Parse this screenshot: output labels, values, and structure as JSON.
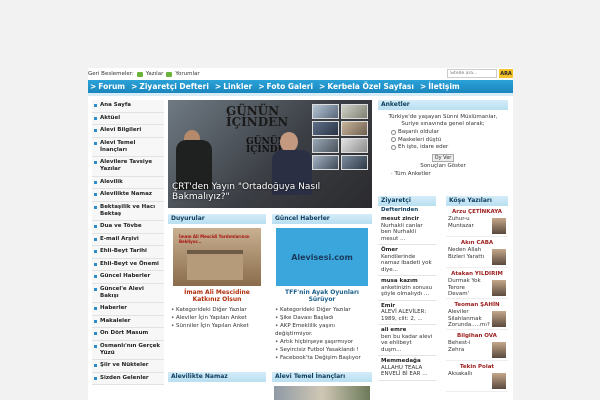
{
  "topbar": {
    "feeds_label": "Geri Beslemeler:",
    "feed1": "Yazılar",
    "feed2": "Yorumlar",
    "search_placeholder": "Sitede ara...",
    "search_button": "ARA"
  },
  "nav": [
    {
      "label": "Forum"
    },
    {
      "label": "Ziyaretçi Defteri"
    },
    {
      "label": "Linkler"
    },
    {
      "label": "Foto Galeri"
    },
    {
      "label": "Kerbela Özel Sayfası"
    },
    {
      "label": "İletişim"
    }
  ],
  "sidebar": {
    "items": [
      "Ana Sayfa",
      "Aktüel",
      "Alevi Bilgileri",
      "Alevi Temel İnançları",
      "Alevilere Tavsiye Yazılar",
      "Alevilik",
      "Alevilikte Namaz",
      "Bektaşilik ve Hacı Bektaş",
      "Dua ve Tövbe",
      "E-mail Arşivi",
      "Ehli-Beyt Tarihi",
      "Ehli-Beyt ve Önemi",
      "Güncel Haberler",
      "Güncel'e Alevi Bakışı",
      "Haberler",
      "Makaleler",
      "On Dört Masum",
      "Osmanlı'nın Gerçek Yüzü",
      "Şiir ve Nükteler",
      "Sizden Gelenler"
    ]
  },
  "featured": {
    "logo_line1": "GÜNÜN",
    "logo_line2": "İÇİNDEN",
    "caption_line1": "ÇRT'den Yayın \"Ortadoğuya Nasıl",
    "caption_line2": "Bakmalıyız?\""
  },
  "poll": {
    "title": "Anketler",
    "question": "Türkiye'de yaşayan Sünni Müslümanlar, Suriye sınavında genel olarak;",
    "options": [
      "Başarılı oldular",
      "Maskeleri düştü",
      "Eh işte, idare eder"
    ],
    "vote_button": "Oy Ver",
    "results_link": "Sonuçları Göster",
    "all_polls": "Tüm Anketler"
  },
  "duyurular": {
    "title": "Duyurular",
    "image_banner": "İmam Ali Mescidi Yardımlarınızı Bekliyor...",
    "headline": "İmam Ali Mescidine Katkınız Olsun",
    "bullets": [
      "Kategorideki Diğer Yazılar",
      "Aleviler İçin Yapılan Anket",
      "Sünniler İçin Yapılan Anket"
    ]
  },
  "guncel": {
    "title": "Güncel Haberler",
    "image_text": "Alevisesi.com",
    "headline": "TFF'nin Ayak Oyunları Sürüyor",
    "bullets": [
      "Kategorideki Diğer Yazılar",
      "Şike Davası Başladı",
      "AKP Emeklilik yaşını değiştirmiyor.",
      "Artık hiçbirşeye şaşırmıyor",
      "Seyircisiz Futbol Yasaklandı !",
      "Facebook'ta Değişim Başlıyor"
    ]
  },
  "bottom": {
    "alevilikte_title": "Alevilikte Namaz",
    "temel_title": "Alevi Temel İnançları"
  },
  "ziyaretci": {
    "title": "Ziyaretçi",
    "subtitle": "Defterinden",
    "entries": [
      {
        "name": "mesut zincir",
        "text": "Nurhakli canlar ben Nurhakli mesut ..."
      },
      {
        "name": "Ömer",
        "text": "Kendilerinde namaz ibadeti yok diye..."
      },
      {
        "name": "musa kazım",
        "text": "anketinizin sonusu şöyle olmalıydı ..."
      },
      {
        "name": "Emir",
        "text": "ALEVİ ALEVİLER: 1989, cilt: 2, ..."
      },
      {
        "name": "ali emre",
        "text": "ben bu kadar alevi ve ehlibeyt duşm..."
      },
      {
        "name": "Memmedağa",
        "text": "ALLAHU TEALA ENVELİ Bİ EAR ..."
      }
    ]
  },
  "kose": {
    "title": "Köşe Yazıları",
    "items": [
      {
        "author": "Arzu ÇETİNKAYA",
        "title": "Zuhur-u Muntazar"
      },
      {
        "author": "Akın CABA",
        "title": "Neden Allah Bizleri Yarattı"
      },
      {
        "author": "Atakan YILDIRIM",
        "title": "Durmak Yok Terore Devam'"
      },
      {
        "author": "Teoman ŞAHİN",
        "title": "Aleviler Silahlanmak Zorunda.....mı?"
      },
      {
        "author": "Bilgihan OVA",
        "title": "Behest-i Zehra"
      },
      {
        "author": "Tekin Polat",
        "title": "Aksakallı"
      }
    ]
  },
  "colors": {
    "nav_blue": "#1a86bd",
    "panel_header": "#b8dff1",
    "accent_red": "#b0300b",
    "search_button": "#f6c22c"
  }
}
